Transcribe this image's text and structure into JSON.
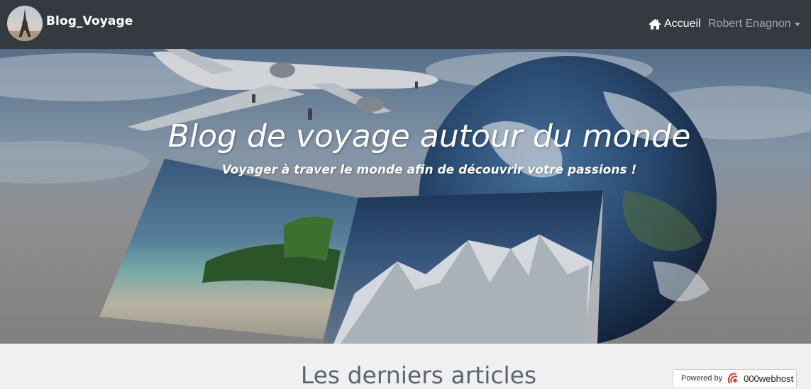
{
  "navbar": {
    "brand": "Blog_Voyage",
    "home_label": "Accueil",
    "user_label": "Robert Enagnon",
    "logo_icon": "eiffel-tower-icon",
    "home_icon": "home-icon"
  },
  "hero": {
    "title": "Blog de voyage autour du monde",
    "subtitle": "Voyager à traver le monde afin de découvrir votre passions !"
  },
  "main": {
    "section_title": "Les derniers articles"
  },
  "badge": {
    "prefix": "Powered by",
    "brand": "000webhost",
    "icon": "000webhost-logo-icon"
  },
  "colors": {
    "navbar": "#343a40",
    "page_bg": "#f0f0f0",
    "title_text": "#5d6570",
    "badge_accent": "#e0392b"
  }
}
